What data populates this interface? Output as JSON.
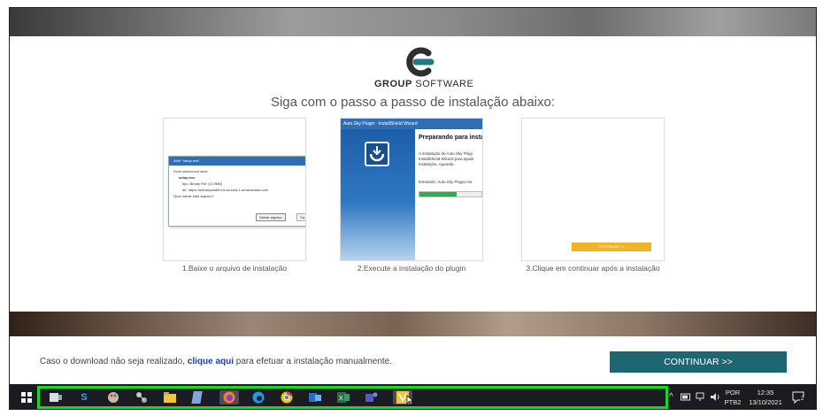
{
  "brand": {
    "name_bold": "GROUP",
    "name_light": "SOFTWARE"
  },
  "headline": "Siga com o passo a passo de instalação abaixo:",
  "steps": [
    {
      "caption": "1.Baixe o arquivo de instalação"
    },
    {
      "caption": "2.Execute a instalação do plugin"
    },
    {
      "caption": "3.Clique em continuar após a instalação"
    }
  ],
  "download_dialog": {
    "title": "Abrir \"setup.exe\"",
    "prompt": "Você selecionou abrir:",
    "file_name": "setup.exe",
    "type_line": "tipo: Binary File (13,9MB)",
    "from_line": "de: https://autoskystabili.s3-sa-east-1.amazonaws.com",
    "question": "Quer salvar este arquivo?",
    "save_label": "Salvar arquivo",
    "cancel_label": "Ca"
  },
  "wizard": {
    "title": "Auto.Sky Plugin - InstallShield Wizard",
    "heading": "Preparando para insta",
    "body_1": "A instalação do Auto.Sky Plugi",
    "body_2": "InstallShield Wizard para ajudá",
    "body_3": "instalação. Aguarde.",
    "extract": "Extraindo: Auto.Sky Plugin.ms",
    "progress": 0.6
  },
  "continue_mini_label": "CONTINUAR >>",
  "footer": {
    "prefix": "Caso o download não seja realizado,",
    "link": "clique aqui",
    "suffix": "para efetuar a instalação manualmente.",
    "button": "CONTINUAR >>"
  },
  "taskbar": {
    "icons": [
      "windows-start-icon",
      "task-view-icon",
      "s-app-icon",
      "paint-icon",
      "network-app-icon",
      "file-explorer-icon",
      "notepad-icon",
      "firefox-icon",
      "edge-icon",
      "chrome-icon",
      "outlook-icon",
      "excel-icon",
      "teams-icon",
      "yellow-app-icon"
    ],
    "language_1": "POR",
    "language_2": "PTB2",
    "time": "12:35",
    "date": "13/10/2021",
    "notifications": "2"
  },
  "colors": {
    "accent": "#1f6673",
    "link": "#1a3fb5",
    "highlight": "#19d926",
    "yellow": "#f0b429"
  }
}
